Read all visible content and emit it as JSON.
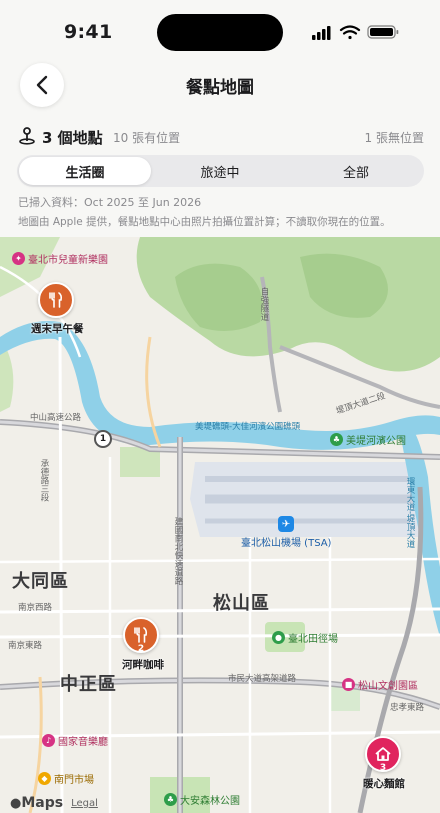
{
  "status_bar": {
    "time": "9:41"
  },
  "header": {
    "title": "餐點地圖"
  },
  "summary": {
    "count": "3 個地點",
    "with_location": "10 張有位置",
    "without_location": "1 張無位置"
  },
  "segments": [
    {
      "label": "生活圈",
      "active": true
    },
    {
      "label": "旅途中",
      "active": false
    },
    {
      "label": "全部",
      "active": false
    }
  ],
  "scan_range": "已掃入資料：Oct 2025 至 Jun 2026",
  "note": "地圖由 Apple 提供，餐點地點中心由照片拍攝位置計算；不讀取你現在的位置。",
  "map": {
    "districts": [
      "大同區",
      "中正區",
      "松山區"
    ],
    "pois": [
      {
        "name": "臺北市兒童新樂園",
        "icon": "amusement-icon",
        "color": "#d63384"
      },
      {
        "name": "美堤河濱公園",
        "icon": "park-icon",
        "color": "#2e9d4a"
      },
      {
        "name": "臺北松山機場 (TSA)",
        "icon": "airplane-icon",
        "color": "#1e88e5"
      },
      {
        "name": "臺北田徑場",
        "icon": "stadium-icon",
        "color": "#2e9d4a"
      },
      {
        "name": "松山文創園區",
        "icon": "museum-icon",
        "color": "#d63384"
      },
      {
        "name": "國家音樂廳",
        "icon": "music-icon",
        "color": "#d63384"
      },
      {
        "name": "南門市場",
        "icon": "market-icon",
        "color": "#f0a800"
      },
      {
        "name": "大安森林公園",
        "icon": "park-icon",
        "color": "#2e9d4a"
      }
    ],
    "roads": [
      "中山高速公路",
      "承德路三段",
      "南京西路",
      "南京東路",
      "市民大道高架道路",
      "忠孝東路",
      "美堤礁頭-大佳河濱公園礁頭",
      "自強隧道",
      "堤頂大道二段",
      "建國南北快速道路",
      "環東大道-堤頂大道"
    ],
    "highway_shield": "1",
    "markers": [
      {
        "name": "週末早午餐",
        "badge": "",
        "icon": "fork-knife-icon",
        "color": "#d9622b"
      },
      {
        "name": "河畔咖啡",
        "badge": "2",
        "icon": "fork-knife-icon",
        "color": "#d9622b"
      },
      {
        "name": "暖心麵館",
        "badge": "3",
        "icon": "house-icon",
        "color": "#e0245e"
      }
    ],
    "attribution": {
      "logo": "Maps",
      "legal": "Legal"
    }
  }
}
